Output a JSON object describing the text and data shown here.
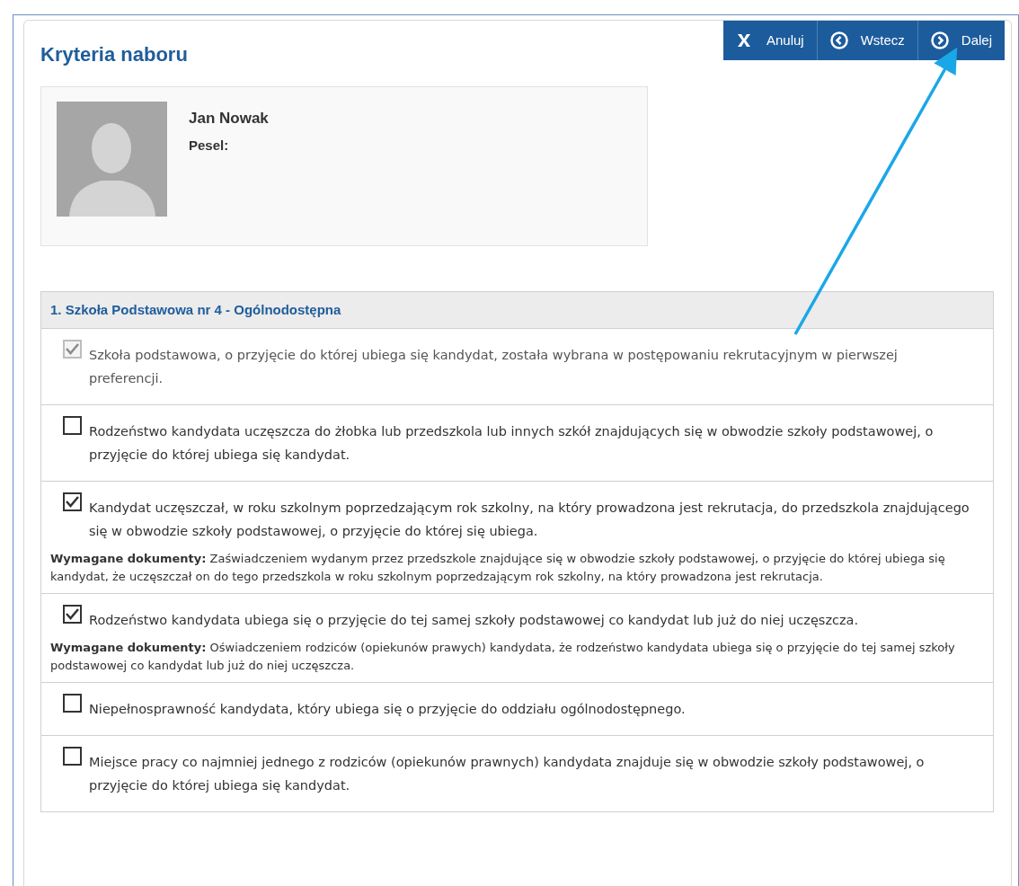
{
  "title": "Kryteria naboru",
  "toolbar": [
    {
      "kind": "cancel",
      "label": "Anuluj"
    },
    {
      "kind": "back",
      "label": "Wstecz"
    },
    {
      "kind": "next",
      "label": "Dalej"
    }
  ],
  "profile": {
    "name": "Jan Nowak",
    "pesel_label": "Pesel:"
  },
  "section": {
    "title": "1. Szkoła Podstawowa nr 4 - Ogólnodostępna",
    "criteria": [
      {
        "text": "Szkoła podstawowa, o przyjęcie do której ubiega się kandydat, została wybrana w postępowaniu rekrutacyjnym w pierwszej preferencji.",
        "checked": true,
        "disabled": true
      },
      {
        "text": "Rodzeństwo kandydata uczęszcza do żłobka lub przedszkola lub innych szkół znajdujących się w obwodzie szkoły podstawowej, o przyjęcie do której ubiega się kandydat.",
        "checked": false,
        "disabled": false
      },
      {
        "text": "Kandydat uczęszczał, w roku szkolnym poprzedzającym rok szkolny, na który prowadzona jest rekrutacja, do przedszkola znajdującego się w obwodzie szkoły podstawowej, o przyjęcie do której się ubiega.",
        "checked": true,
        "disabled": false,
        "documents": "**Wymagane dokumenty:** Zaświadczeniem wydanym przez przedszkole znajdujące się w obwodzie szkoły podstawowej, o przyjęcie do której ubiega się kandydat, że uczęszczał on do tego przedszkola w roku szkolnym poprzedzającym rok szkolny, na który prowadzona jest rekrutacja."
      },
      {
        "text": "Rodzeństwo kandydata ubiega się o przyjęcie do tej samej szkoły podstawowej co kandydat lub już do niej uczęszcza.",
        "checked": true,
        "disabled": false,
        "documents": "**Wymagane dokumenty:** Oświadczeniem rodziców (opiekunów prawych) kandydata, że rodzeństwo kandydata ubiega się o przyjęcie do tej samej szkoły podstawowej co kandydat lub już do niej uczęszcza."
      },
      {
        "text": "Niepełnosprawność kandydata, który ubiega się o przyjęcie do oddziału ogólnodostępnego.",
        "checked": false,
        "disabled": false
      },
      {
        "text": "Miejsce pracy co najmniej jednego z rodziców (opiekunów prawnych) kandydata znajduje się w obwodzie szkoły podstawowej, o przyjęcie do której ubiega się kandydat.",
        "checked": false,
        "disabled": false
      }
    ]
  }
}
